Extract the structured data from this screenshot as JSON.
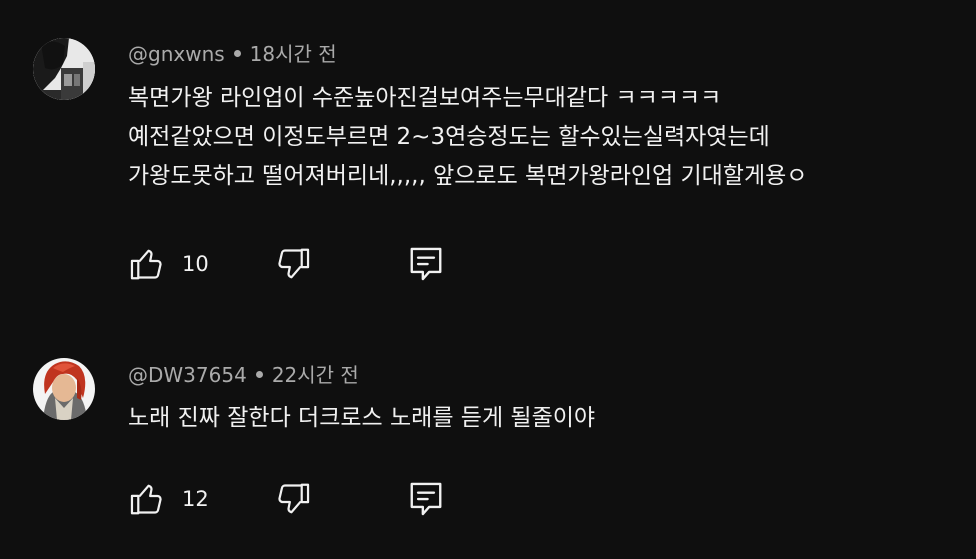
{
  "comments": [
    {
      "author": "@gnxwns",
      "time": "18시간 전",
      "lines": [
        "복면가왕 라인업이 수준높아진걸보여주는무대같다 ㅋㅋㅋㅋㅋ",
        "예전같았으면 이정도부르면 2~3연승정도는 할수있는실력자엿는데",
        "가왕도못하고 떨어져버리네,,,,, 앞으로도 복면가왕라인업 기대할게용ㅇ"
      ],
      "likes": "10"
    },
    {
      "author": "@DW37654",
      "time": "22시간 전",
      "lines": [
        "노래 진짜 잘한다 더크로스 노래를 듣게 될줄이야"
      ],
      "likes": "12"
    }
  ],
  "icons": {
    "like": "thumbs-up-icon",
    "dislike": "thumbs-down-icon",
    "reply": "reply-comment-icon"
  },
  "colors": {
    "background": "#0f0f0f",
    "text": "#f1f1f1",
    "meta": "#aaaaaa"
  }
}
